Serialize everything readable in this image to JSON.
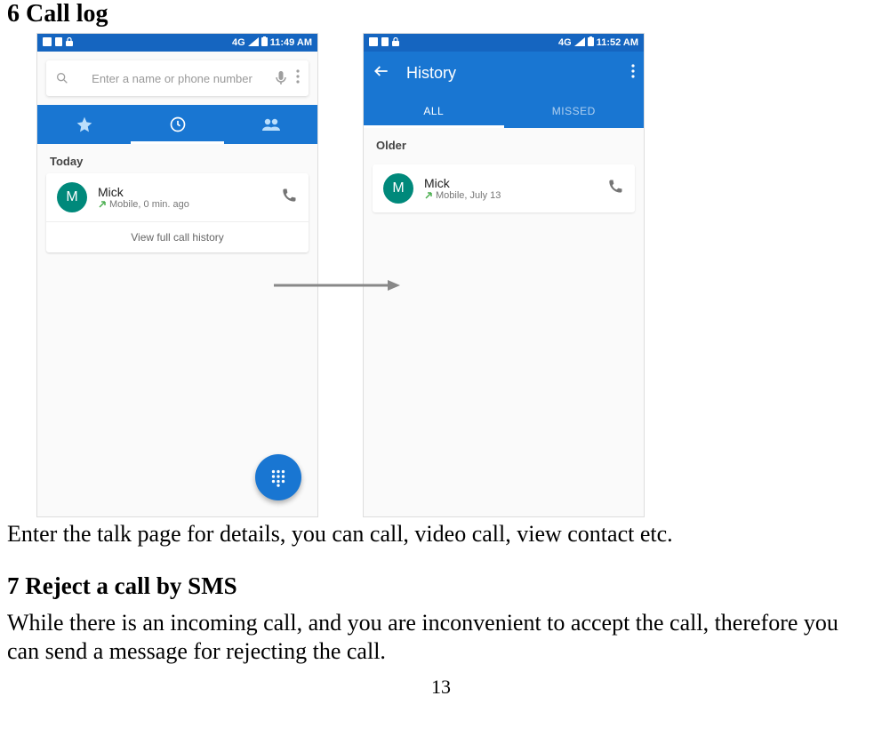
{
  "section6": {
    "title": "6 Call log",
    "body": "Enter the talk page for details, you can call, video call, view contact etc."
  },
  "section7": {
    "title": "7 Reject a call by SMS",
    "body": "While there is an incoming call, and you are inconvenient to accept the call, therefore you can send a message for rejecting the call."
  },
  "page_number": "13",
  "phone1": {
    "status_time": "11:49 AM",
    "status_network": "4G",
    "search_placeholder": "Enter a name or phone number",
    "section_label": "Today",
    "entry": {
      "avatar_letter": "M",
      "name": "Mick",
      "subtitle": "Mobile, 0 min. ago"
    },
    "view_history": "View full call history"
  },
  "phone2": {
    "status_time": "11:52 AM",
    "status_network": "4G",
    "header_title": "History",
    "tab_all": "ALL",
    "tab_missed": "MISSED",
    "section_label": "Older",
    "entry": {
      "avatar_letter": "M",
      "name": "Mick",
      "subtitle": "Mobile, July 13"
    }
  }
}
